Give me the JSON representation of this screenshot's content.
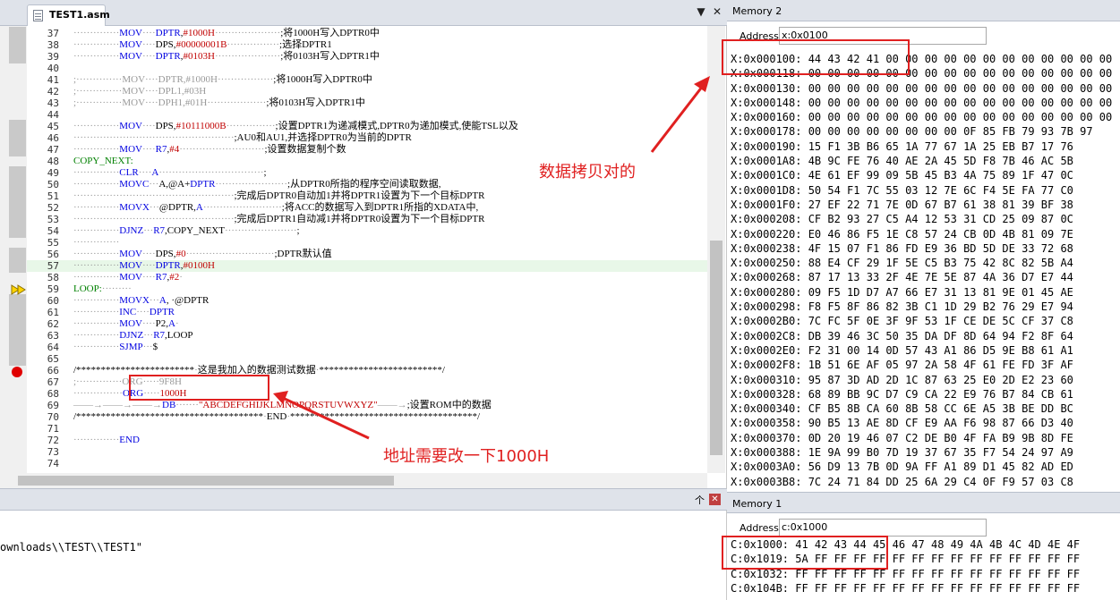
{
  "editor": {
    "tab_title": "TEST1.asm",
    "dropdown_glyph": "▼",
    "close_glyph": "✕",
    "lines": [
      {
        "n": "37",
        "parts": [
          [
            "dt",
            "··············"
          ],
          [
            "kw",
            "MOV"
          ],
          [
            "dt",
            "····"
          ],
          [
            "kw",
            "DPTR"
          ],
          [
            "",
            ","
          ],
          [
            "nm",
            "#1000H"
          ],
          [
            "dt",
            "····················"
          ],
          [
            "",
            ";将1000H写入DPTR0中"
          ]
        ]
      },
      {
        "n": "38",
        "parts": [
          [
            "dt",
            "··············"
          ],
          [
            "kw",
            "MOV"
          ],
          [
            "dt",
            "····"
          ],
          [
            "",
            "DPS,"
          ],
          [
            "nm",
            "#00000001B"
          ],
          [
            "dt",
            "················"
          ],
          [
            "",
            ";选择DPTR1"
          ]
        ]
      },
      {
        "n": "39",
        "parts": [
          [
            "dt",
            "··············"
          ],
          [
            "kw",
            "MOV"
          ],
          [
            "dt",
            "····"
          ],
          [
            "kw",
            "DPTR"
          ],
          [
            "",
            ","
          ],
          [
            "nm",
            "#0103H"
          ],
          [
            "dt",
            "····················"
          ],
          [
            "",
            ";将0103H写入DPTR1中"
          ]
        ]
      },
      {
        "n": "40",
        "parts": []
      },
      {
        "n": "41",
        "parts": [
          [
            "dt",
            ";··············"
          ],
          [
            "dt",
            "MOV"
          ],
          [
            "dt",
            "····"
          ],
          [
            "dt",
            "DPTR,#1000H"
          ],
          [
            "dt",
            "·················"
          ],
          [
            "",
            ";将1000H写入DPTR0中"
          ]
        ]
      },
      {
        "n": "42",
        "parts": [
          [
            "dt",
            ";··············"
          ],
          [
            "dt",
            "MOV"
          ],
          [
            "dt",
            "····"
          ],
          [
            "dt",
            "DPL1,#03H"
          ]
        ]
      },
      {
        "n": "43",
        "parts": [
          [
            "dt",
            ";··············"
          ],
          [
            "dt",
            "MOV"
          ],
          [
            "dt",
            "····"
          ],
          [
            "dt",
            "DPH1,#01H"
          ],
          [
            "dt",
            "··················"
          ],
          [
            "",
            ";将0103H写入DPTR1中"
          ]
        ]
      },
      {
        "n": "44",
        "parts": []
      },
      {
        "n": "45",
        "parts": [
          [
            "dt",
            "··············"
          ],
          [
            "kw",
            "MOV"
          ],
          [
            "dt",
            "····"
          ],
          [
            "",
            "DPS,"
          ],
          [
            "nm",
            "#10111000B"
          ],
          [
            "dt",
            "···············"
          ],
          [
            "",
            ";设置DPTR1为递减模式,DPTR0为递加模式,使能TSL以及"
          ]
        ]
      },
      {
        "n": "46",
        "parts": [
          [
            "dt",
            "·················································"
          ],
          [
            "",
            ";AU0和AU1,并选择DPTR0为当前的DPTR"
          ]
        ]
      },
      {
        "n": "47",
        "parts": [
          [
            "dt",
            "··············"
          ],
          [
            "kw",
            "MOV"
          ],
          [
            "dt",
            "····"
          ],
          [
            "kw",
            "R7"
          ],
          [
            "",
            ","
          ],
          [
            "nm",
            "#4"
          ],
          [
            "dt",
            "··························"
          ],
          [
            "",
            ";设置数据复制个数"
          ]
        ]
      },
      {
        "n": "48",
        "parts": [
          [
            "lb",
            "COPY_NEXT:"
          ]
        ]
      },
      {
        "n": "49",
        "parts": [
          [
            "dt",
            "··············"
          ],
          [
            "kw",
            "CLR"
          ],
          [
            "dt",
            "····"
          ],
          [
            "kw",
            "A"
          ],
          [
            "dt",
            "································"
          ],
          [
            "",
            ";"
          ]
        ]
      },
      {
        "n": "50",
        "parts": [
          [
            "dt",
            "··············"
          ],
          [
            "kw",
            "MOVC"
          ],
          [
            "dt",
            "···"
          ],
          [
            "",
            "A,@A+"
          ],
          [
            "kw",
            "DPTR"
          ],
          [
            "dt",
            "······················"
          ],
          [
            "",
            ";从DPTR0所指的程序空间读取数据,"
          ]
        ]
      },
      {
        "n": "51",
        "parts": [
          [
            "dt",
            "·················································"
          ],
          [
            "",
            ";完成后DPTR0自动加1并将DPTR1设置为下一个目标DPTR"
          ]
        ]
      },
      {
        "n": "52",
        "parts": [
          [
            "dt",
            "··············"
          ],
          [
            "kw",
            "MOVX"
          ],
          [
            "dt",
            "···"
          ],
          [
            "",
            "@DPTR,"
          ],
          [
            "kw",
            "A"
          ],
          [
            "dt",
            "························"
          ],
          [
            "",
            ";将ACC的数据写入到DPTR1所指的XDATA中,"
          ]
        ]
      },
      {
        "n": "53",
        "parts": [
          [
            "dt",
            "·················································"
          ],
          [
            "",
            ";完成后DPTR1自动减1并将DPTR0设置为下一个目标DPTR"
          ]
        ]
      },
      {
        "n": "54",
        "parts": [
          [
            "dt",
            "··············"
          ],
          [
            "kw",
            "DJNZ"
          ],
          [
            "dt",
            "···"
          ],
          [
            "kw",
            "R7"
          ],
          [
            "",
            ",COPY_NEXT"
          ],
          [
            "dt",
            "······················"
          ],
          [
            "",
            ";"
          ]
        ]
      },
      {
        "n": "55",
        "parts": [
          [
            "dt",
            "··············"
          ]
        ]
      },
      {
        "n": "56",
        "parts": [
          [
            "dt",
            "··············"
          ],
          [
            "kw",
            "MOV"
          ],
          [
            "dt",
            "····"
          ],
          [
            "",
            "DPS,"
          ],
          [
            "nm",
            "#0"
          ],
          [
            "dt",
            "···························"
          ],
          [
            "",
            ";DPTR默认值"
          ]
        ]
      },
      {
        "n": "57",
        "hl": true,
        "parts": [
          [
            "dt",
            "··············"
          ],
          [
            "kw",
            "MOV"
          ],
          [
            "dt",
            "····"
          ],
          [
            "kw",
            "DPTR"
          ],
          [
            "",
            ","
          ],
          [
            "nm",
            "#0100H"
          ]
        ]
      },
      {
        "n": "58",
        "parts": [
          [
            "dt",
            "··············"
          ],
          [
            "kw",
            "MOV"
          ],
          [
            "dt",
            "····"
          ],
          [
            "kw",
            "R7"
          ],
          [
            "",
            ","
          ],
          [
            "nm",
            "#2"
          ],
          [
            "dt",
            "·"
          ]
        ]
      },
      {
        "n": "59",
        "parts": [
          [
            "lb",
            "LOOP:"
          ],
          [
            "dt",
            "·········"
          ]
        ]
      },
      {
        "n": "60",
        "parts": [
          [
            "dt",
            "··············"
          ],
          [
            "kw",
            "MOVX"
          ],
          [
            "dt",
            "···"
          ],
          [
            "kw",
            "A"
          ],
          [
            "",
            ", ·@DPTR"
          ]
        ]
      },
      {
        "n": "61",
        "parts": [
          [
            "dt",
            "··············"
          ],
          [
            "kw",
            "INC"
          ],
          [
            "dt",
            "····"
          ],
          [
            "kw",
            "DPTR"
          ]
        ]
      },
      {
        "n": "62",
        "parts": [
          [
            "dt",
            "··············"
          ],
          [
            "kw",
            "MOV"
          ],
          [
            "dt",
            "····"
          ],
          [
            "",
            "P2,"
          ],
          [
            "kw",
            "A"
          ],
          [
            "dt",
            "·"
          ]
        ]
      },
      {
        "n": "63",
        "parts": [
          [
            "dt",
            "··············"
          ],
          [
            "kw",
            "DJNZ"
          ],
          [
            "dt",
            "···"
          ],
          [
            "kw",
            "R7"
          ],
          [
            "",
            ",LOOP"
          ]
        ]
      },
      {
        "n": "64",
        "parts": [
          [
            "dt",
            "··············"
          ],
          [
            "kw",
            "SJMP"
          ],
          [
            "dt",
            "···"
          ],
          [
            "",
            "$"
          ]
        ]
      },
      {
        "n": "65",
        "parts": []
      },
      {
        "n": "66",
        "parts": [
          [
            "",
            "/************************"
          ],
          [
            "dt",
            "·"
          ],
          [
            "",
            "这是我加入的数据测试数据"
          ],
          [
            "dt",
            "·"
          ],
          [
            "",
            "*************************/"
          ]
        ]
      },
      {
        "n": "67",
        "parts": [
          [
            "dt",
            ";··············"
          ],
          [
            "dt",
            "ORG"
          ],
          [
            "dt",
            "·····"
          ],
          [
            "dt",
            "9F8H"
          ]
        ]
      },
      {
        "n": "68",
        "parts": [
          [
            "dt",
            "···············"
          ],
          [
            "kw",
            "ORG"
          ],
          [
            "dt",
            "·····"
          ],
          [
            "nm",
            "1000H"
          ]
        ]
      },
      {
        "n": "69",
        "parts": [
          [
            "dt",
            "——→——→——→"
          ],
          [
            "kw",
            "DB"
          ],
          [
            "dt",
            "·······"
          ],
          [
            "nm",
            "\"ABCDEFGHIJKLMNOPQRSTUVWXYZ\""
          ],
          [
            "dt",
            "——→"
          ],
          [
            "",
            ";设置ROM中的数据"
          ]
        ]
      },
      {
        "n": "70",
        "parts": [
          [
            "",
            "/**************************************"
          ],
          [
            "dt",
            "·"
          ],
          [
            "",
            "END"
          ],
          [
            "dt",
            "·"
          ],
          [
            "",
            "**************************************/"
          ]
        ]
      },
      {
        "n": "71",
        "parts": []
      },
      {
        "n": "72",
        "parts": [
          [
            "dt",
            "··············"
          ],
          [
            "kw",
            "END"
          ]
        ]
      },
      {
        "n": "73",
        "parts": []
      },
      {
        "n": "74",
        "parts": []
      }
    ]
  },
  "output": {
    "line": "ownloads\\\\TEST\\\\TEST1\"",
    "pin_glyph": "个",
    "close_glyph": "✕"
  },
  "memory2": {
    "title": "Memory 2",
    "address_label": "Address:",
    "address_value": "x:0x0100",
    "rows": [
      "X:0x000100: 44 43 42 41 00 00 00 00 00 00 00 00 00 00 00 00",
      "X:0x000118: 00 00 00 00 00 00 00 00 00 00 00 00 00 00 00 00",
      "X:0x000130: 00 00 00 00 00 00 00 00 00 00 00 00 00 00 00 00",
      "X:0x000148: 00 00 00 00 00 00 00 00 00 00 00 00 00 00 00 00",
      "X:0x000160: 00 00 00 00 00 00 00 00 00 00 00 00 00 00 00 00",
      "X:0x000178: 00 00 00 00 00 00 00 00 0F 85 FB 79 93 7B 97",
      "X:0x000190: 15 F1 3B B6 65 1A 77 67 1A 25 EB B7 17 76",
      "X:0x0001A8: 4B 9C FE 76 40 AE 2A 45 5D F8 7B 46 AC 5B",
      "X:0x0001C0: 4E 61 EF 99 09 5B 45 B3 4A 75 89 1F 47 0C",
      "X:0x0001D8: 50 54 F1 7C 55 03 12 7E 6C F4 5E FA 77 C0",
      "X:0x0001F0: 27 EF 22 71 7E 0D 67 B7 61 38 81 39 BF 38",
      "X:0x000208: CF B2 93 27 C5 A4 12 53 31 CD 25 09 87 0C",
      "X:0x000220: E0 46 86 F5 1E C8 57 24 CB 0D 4B 81 09 7E",
      "X:0x000238: 4F 15 07 F1 86 FD E9 36 BD 5D DE 33 72 68",
      "X:0x000250: 88 E4 CF 29 1F 5E C5 B3 75 42 8C 82 5B A4",
      "X:0x000268: 87 17 13 33 2F 4E 7E 5E 87 4A 36 D7 E7 44",
      "X:0x000280: 09 F5 1D D7 A7 66 E7 31 13 81 9E 01 45 AE",
      "X:0x000298: F8 F5 8F 86 82 3B C1 1D 29 B2 76 29 E7 94",
      "X:0x0002B0: 7C FC 5F 0E 3F 9F 53 1F CE DE 5C CF 37 C8",
      "X:0x0002C8: DB 39 46 3C 50 35 DA DF 8D 64 94 F2 8F 64",
      "X:0x0002E0: F2 31 00 14 0D 57 43 A1 86 D5 9E B8 61 A1",
      "X:0x0002F8: 1B 51 6E AF 05 97 2A 58 4F 61 FE FD 3F AF",
      "X:0x000310: 95 87 3D AD 2D 1C 87 63 25 E0 2D E2 23 60",
      "X:0x000328: 68 89 BB 9C D7 C9 CA 22 E9 76 B7 84 CB 61",
      "X:0x000340: CF B5 8B CA 60 8B 58 CC 6E A5 3B BE DD BC",
      "X:0x000358: 90 B5 13 AE 8D CF E9 AA F6 98 87 66 D3 40",
      "X:0x000370: 0D 20 19 46 07 C2 DE B0 4F FA B9 9B 8D FE",
      "X:0x000388: 1E 9A 99 B0 7D 19 37 67 35 F7 54 24 97 A9",
      "X:0x0003A0: 56 D9 13 7B 0D 9A FF A1 89 D1 45 82 AD ED",
      "X:0x0003B8: 7C 24 71 84 DD 25 6A 29 C4 0F F9 57 03 C8",
      "X:0x0003D0: F3 FC 56 23 D4 66 40 FA 87 2D 9A 1E D3 FC"
    ]
  },
  "memory1": {
    "title": "Memory 1",
    "address_label": "Address:",
    "address_value": "c:0x1000",
    "rows": [
      "C:0x1000: 41 42 43 44 45 46 47 48 49 4A 4B 4C 4D 4E 4F",
      "C:0x1019: 5A FF FF FF FF FF FF FF FF FF FF FF FF FF FF",
      "C:0x1032: FF FF FF FF FF FF FF FF FF FF FF FF FF FF FF",
      "C:0x104B: FF FF FF FF FF FF FF FF FF FF FF FF FF FF FF"
    ]
  },
  "annotations": {
    "note_copy_ok": "数据拷贝对的",
    "note_change_address": "地址需要改一下1000H",
    "accent_color": "#e02020"
  }
}
